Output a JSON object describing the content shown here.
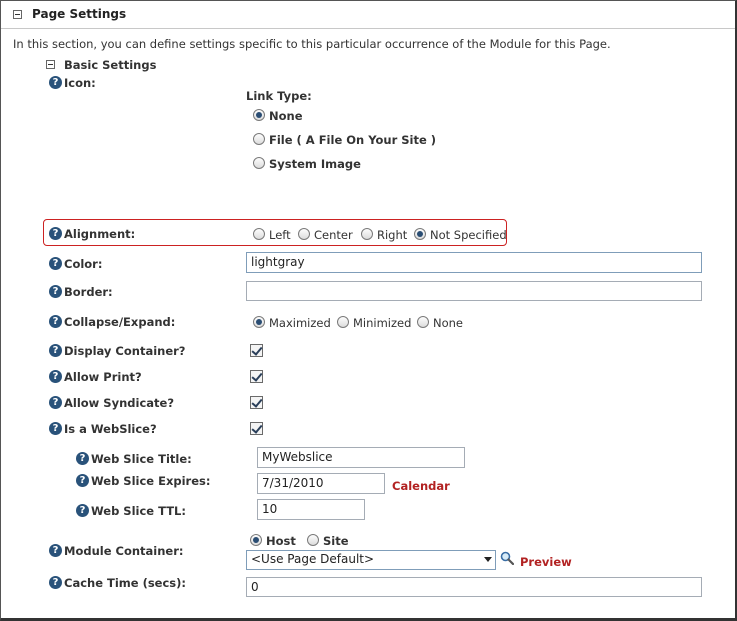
{
  "section": {
    "title": "Page Settings",
    "intro": "In this section, you can define settings specific to this particular occurrence of the Module for this Page."
  },
  "basic": {
    "title": "Basic Settings",
    "icon": {
      "label": "Icon:",
      "link_type_label": "Link Type:",
      "options": [
        "None",
        "File ( A File On Your Site )",
        "System Image"
      ],
      "selected": "None"
    },
    "alignment": {
      "label": "Alignment:",
      "options": [
        "Left",
        "Center",
        "Right",
        "Not Specified"
      ],
      "selected": "Not Specified"
    },
    "color": {
      "label": "Color:",
      "value": "lightgray"
    },
    "border": {
      "label": "Border:",
      "value": ""
    },
    "collapse": {
      "label": "Collapse/Expand:",
      "options": [
        "Maximized",
        "Minimized",
        "None"
      ],
      "selected": "Maximized"
    },
    "display_container": {
      "label": "Display Container?",
      "checked": true
    },
    "allow_print": {
      "label": "Allow Print?",
      "checked": true
    },
    "allow_syndicate": {
      "label": "Allow Syndicate?",
      "checked": true
    },
    "webslice": {
      "label": "Is a WebSlice?",
      "checked": true
    },
    "webslice_title": {
      "label": "Web Slice Title:",
      "value": "MyWebslice"
    },
    "webslice_expires": {
      "label": "Web Slice Expires:",
      "value": "7/31/2010",
      "calendar_link": "Calendar"
    },
    "webslice_ttl": {
      "label": "Web Slice TTL:",
      "value": "10"
    },
    "module_container": {
      "label": "Module Container:",
      "options": [
        "Host",
        "Site"
      ],
      "selected": "Host",
      "select_value": "<Use Page Default>",
      "preview_link": "Preview"
    },
    "cache_time": {
      "label": "Cache Time (secs):",
      "value": "0"
    }
  },
  "icons": {
    "help": "help-icon",
    "toggle": "collapse-icon",
    "magnifier": "magnifier-icon"
  },
  "colors": {
    "highlight_border": "#cc2222",
    "link": "#b22222",
    "help_icon": "#29527a"
  }
}
